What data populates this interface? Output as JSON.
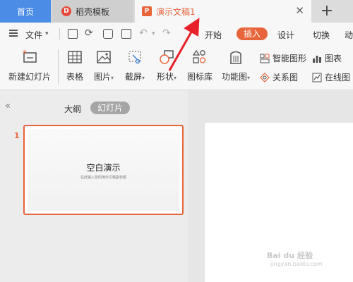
{
  "tabs": {
    "home": "首页",
    "template": "稻壳模板",
    "doc": "演示文稿1",
    "add": "+"
  },
  "menu": {
    "file": "文件",
    "start": "开始",
    "insert": "插入",
    "design": "设计",
    "transition": "切换",
    "animation": "动"
  },
  "ribbon": {
    "new_slide": "新建幻灯片",
    "table": "表格",
    "picture": "图片",
    "screenshot": "截屏",
    "shape": "形状",
    "icon_lib": "图标库",
    "function_chart": "功能图",
    "smart_shape": "智能图形",
    "relation_chart": "关系图",
    "chart": "图表",
    "online_chart": "在线图"
  },
  "panel": {
    "outline": "大纲",
    "slides": "幻灯片",
    "slide_number": "1",
    "slide_title": "空白演示",
    "slide_subtitle": "在此输入您的演示文稿副标题"
  },
  "watermark": {
    "text": "Bai du 经验",
    "url": "jingyan.baidu.com"
  },
  "colors": {
    "accent": "#e8643a",
    "home_tab": "#4b8ce6",
    "arrow": "#e8202a"
  }
}
